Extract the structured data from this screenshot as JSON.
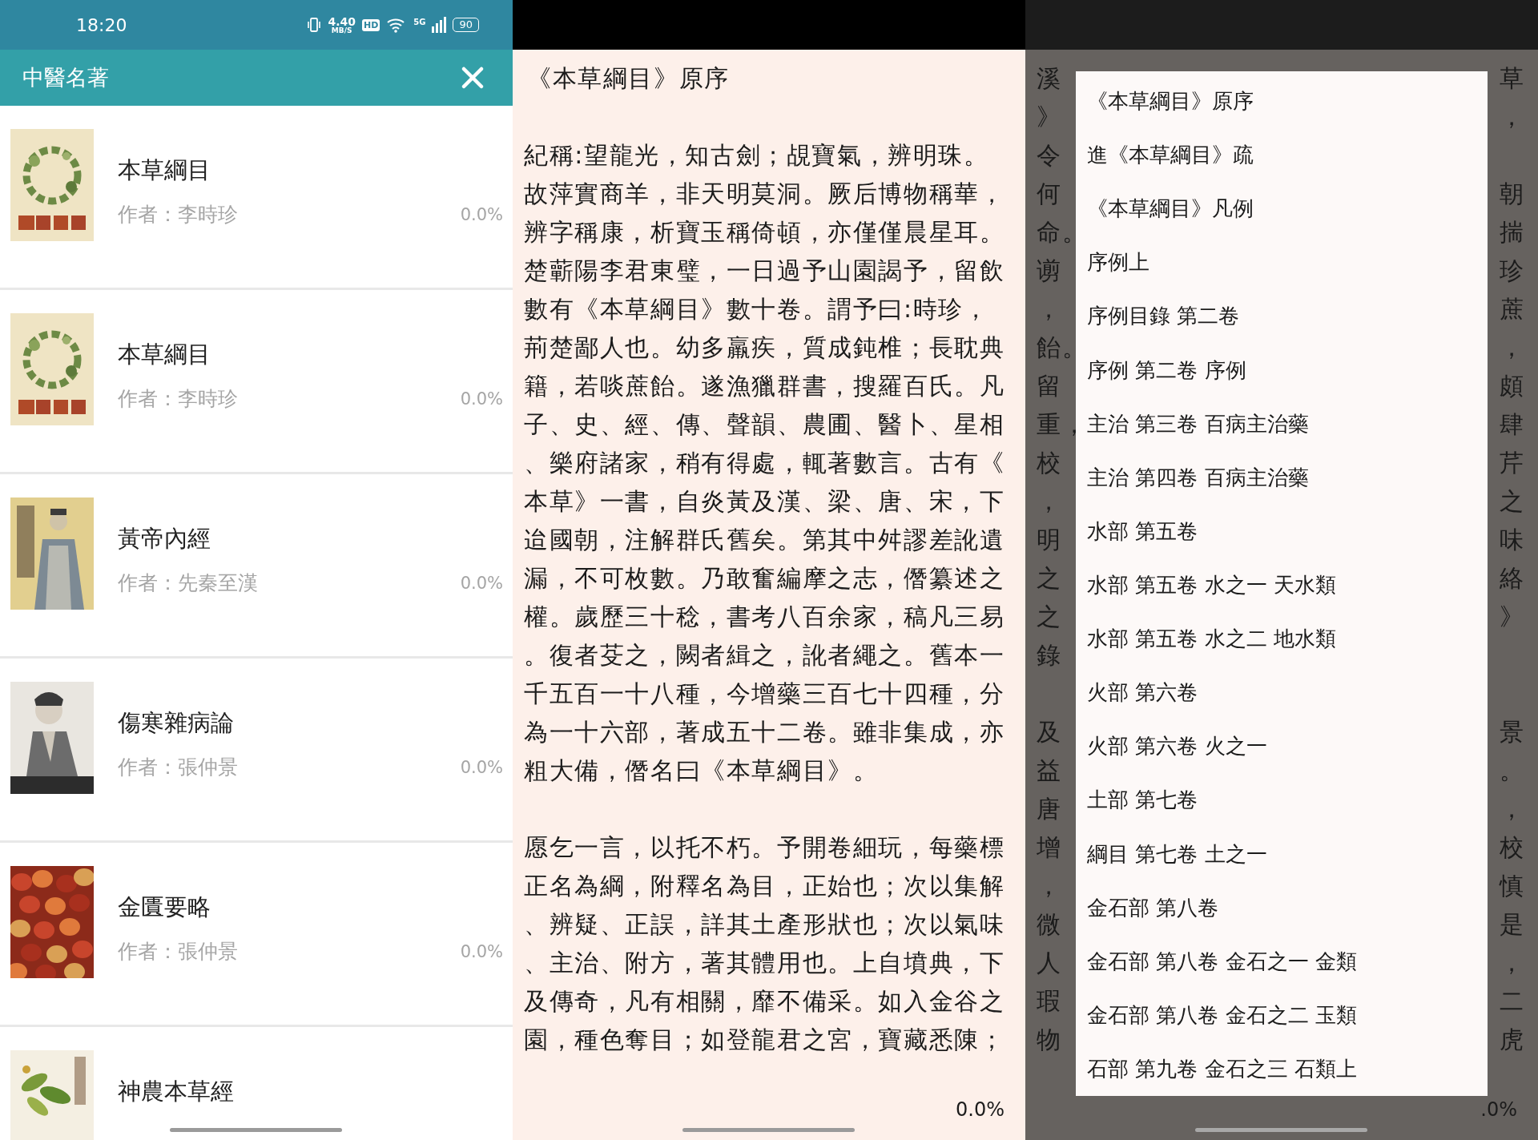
{
  "status_bar": {
    "time": "18:20",
    "speed": "4.40",
    "speed_unit": "MB/S",
    "hd": "HD",
    "network": "5G",
    "battery": "90"
  },
  "header": {
    "title": "中醫名著"
  },
  "books": [
    {
      "title": "本草綱目",
      "author": "作者：李時珍",
      "progress": "0.0%"
    },
    {
      "title": "本草綱目",
      "author": "作者：李時珍",
      "progress": "0.0%"
    },
    {
      "title": "黃帝內經",
      "author": "作者：先秦至漢",
      "progress": "0.0%"
    },
    {
      "title": "傷寒雜病論",
      "author": "作者：張仲景",
      "progress": "0.0%"
    },
    {
      "title": "金匱要略",
      "author": "作者：張仲景",
      "progress": "0.0%"
    },
    {
      "title": "神農本草經"
    }
  ],
  "reader": {
    "title": "《本草綱目》原序",
    "paragraphs": [
      [
        "紀稱:望龍光，知古劍；覘寶氣，辨明珠。",
        "故萍實商羊，非天明莫洞。厥后博物稱華，",
        "辨字稱康，析寶玉稱倚頓，亦僅僅晨星耳。",
        "楚蘄陽李君東璧，一日過予山園謁予，留飲",
        "數有《本草綱目》數十卷。謂予曰:時珍，",
        "荊楚鄙人也。幼多羸疾，質成鈍椎；長耽典",
        "籍，若啖蔗飴。遂漁獵群書，搜羅百氏。凡",
        "子、史、經、傳、聲韻、農圃、醫卜、星相",
        "、樂府諸家，稍有得處，輒著數言。古有《",
        "本草》一書，自炎黃及漢、梁、唐、宋，下",
        "迨國朝，注解群氏舊矣。第其中舛謬差訛遺",
        "漏，不可枚數。乃敢奮編摩之志，僭纂述之",
        "權。歲歷三十稔，書考八百余家，稿凡三易",
        "。復者芟之，闕者緝之，訛者繩之。舊本一",
        "千五百一十八種，今增藥三百七十四種，分",
        "為一十六部，著成五十二卷。雖非集成，亦",
        "粗大備，僭名曰《本草綱目》。"
      ],
      [
        "愿乞一言，以托不朽。予開卷細玩，每藥標",
        "正名為綱，附釋名為目，正始也；次以集解",
        "、辨疑、正誤，詳其土產形狀也；次以氣味",
        "、主治、附方，著其體用也。上自墳典，下",
        "及傳奇，凡有相關，靡不備采。如入金谷之",
        "園，種色奪目；如登龍君之宮，寶藏悉陳；"
      ]
    ],
    "progress": "0.0%"
  },
  "toc_background": {
    "paragraphs": [
      [
        {
          "left": "溪",
          "right": "草"
        },
        {
          "left": "》",
          "right": "，"
        },
        {
          "left": "令"
        },
        {
          "left": "何",
          "right": "朝"
        },
        {
          "left": "命。",
          "right": "揣"
        },
        {
          "left": "谫",
          "right": "珍"
        },
        {
          "left": "，",
          "right": "蔗"
        },
        {
          "left": "飴。",
          "right": "，"
        },
        {
          "left": "留",
          "right": "頗"
        },
        {
          "left": "重，",
          "right": "肆"
        },
        {
          "left": "校",
          "right": "芹"
        },
        {
          "left": "，",
          "right": "之"
        },
        {
          "left": "明",
          "right": "味"
        },
        {
          "left": "之",
          "right": "絡"
        },
        {
          "left": "之",
          "right": "》"
        },
        {
          "left": "錄"
        }
      ],
      [
        {
          "left": "及",
          "right": "景"
        },
        {
          "left": "益",
          "right": "。"
        },
        {
          "left": "唐",
          "right": "，"
        },
        {
          "left": "增",
          "right": "校"
        },
        {
          "left": "，",
          "right": "慎"
        },
        {
          "left": "微",
          "right": "是"
        },
        {
          "left": "人",
          "right": "，"
        },
        {
          "left": "瑕",
          "right": "二"
        },
        {
          "left": "物",
          "right": "虎"
        }
      ]
    ],
    "progress": ".0%"
  },
  "toc": {
    "items": [
      "《本草綱目》原序",
      "進《本草綱目》疏",
      "《本草綱目》凡例",
      "序例上",
      "序例目錄 第二卷",
      "序例 第二卷 序例",
      "主治 第三卷 百病主治藥",
      "主治 第四卷 百病主治藥",
      "水部 第五卷",
      "水部 第五卷 水之一 天水類",
      "水部 第五卷 水之二 地水類",
      "火部 第六卷",
      "火部 第六卷 火之一",
      "土部 第七卷",
      "綱目 第七卷 土之一",
      "金石部 第八卷",
      "金石部 第八卷 金石之一 金類",
      "金石部 第八卷 金石之二 玉類",
      "石部 第九卷 金石之三 石類上"
    ]
  }
}
